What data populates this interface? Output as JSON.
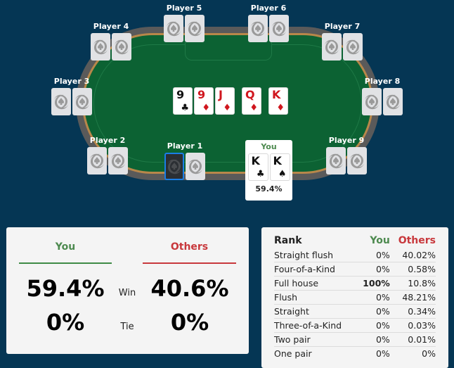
{
  "colors": {
    "background": "#053654",
    "felt": "#0c6233",
    "you": "#4d8a4f",
    "others": "#c8383c",
    "selected": "#1a7ee6"
  },
  "players": [
    {
      "name": "Player 1",
      "cards": [
        "back-selected",
        "back"
      ]
    },
    {
      "name": "Player 2",
      "cards": [
        "back",
        "back"
      ]
    },
    {
      "name": "Player 3",
      "cards": [
        "back",
        "back"
      ]
    },
    {
      "name": "Player 4",
      "cards": [
        "back",
        "back"
      ]
    },
    {
      "name": "Player 5",
      "cards": [
        "back",
        "back"
      ]
    },
    {
      "name": "Player 6",
      "cards": [
        "back",
        "back"
      ]
    },
    {
      "name": "Player 7",
      "cards": [
        "back",
        "back"
      ]
    },
    {
      "name": "Player 8",
      "cards": [
        "back",
        "back"
      ]
    },
    {
      "name": "Player 9",
      "cards": [
        "back",
        "back"
      ]
    }
  ],
  "card_back_icon": "spade-swirl-logo-icon",
  "board": [
    {
      "rank": "9",
      "suit": "♣",
      "color": "black"
    },
    {
      "rank": "9",
      "suit": "♦",
      "color": "red"
    },
    {
      "rank": "J",
      "suit": "♦",
      "color": "red"
    },
    {
      "rank": "Q",
      "suit": "♦",
      "color": "red"
    },
    {
      "rank": "K",
      "suit": "♦",
      "color": "red"
    }
  ],
  "you": {
    "label": "You",
    "cards": [
      {
        "rank": "K",
        "suit": "♣",
        "color": "black"
      },
      {
        "rank": "K",
        "suit": "♠",
        "color": "black"
      }
    ],
    "equity": "59.4%"
  },
  "summary": {
    "you_label": "You",
    "others_label": "Others",
    "win_label": "Win",
    "tie_label": "Tie",
    "you_win": "59.4%",
    "others_win": "40.6%",
    "you_tie": "0%",
    "others_tie": "0%"
  },
  "ranks": {
    "headers": {
      "rank": "Rank",
      "you": "You",
      "others": "Others"
    },
    "rows": [
      {
        "name": "Straight flush",
        "you": "0%",
        "others": "40.02%"
      },
      {
        "name": "Four-of-a-Kind",
        "you": "0%",
        "others": "0.58%"
      },
      {
        "name": "Full house",
        "you": "100%",
        "others": "10.8%",
        "you_bold": true
      },
      {
        "name": "Flush",
        "you": "0%",
        "others": "48.21%"
      },
      {
        "name": "Straight",
        "you": "0%",
        "others": "0.34%"
      },
      {
        "name": "Three-of-a-Kind",
        "you": "0%",
        "others": "0.03%"
      },
      {
        "name": "Two pair",
        "you": "0%",
        "others": "0.01%"
      },
      {
        "name": "One pair",
        "you": "0%",
        "others": "0%"
      }
    ]
  }
}
